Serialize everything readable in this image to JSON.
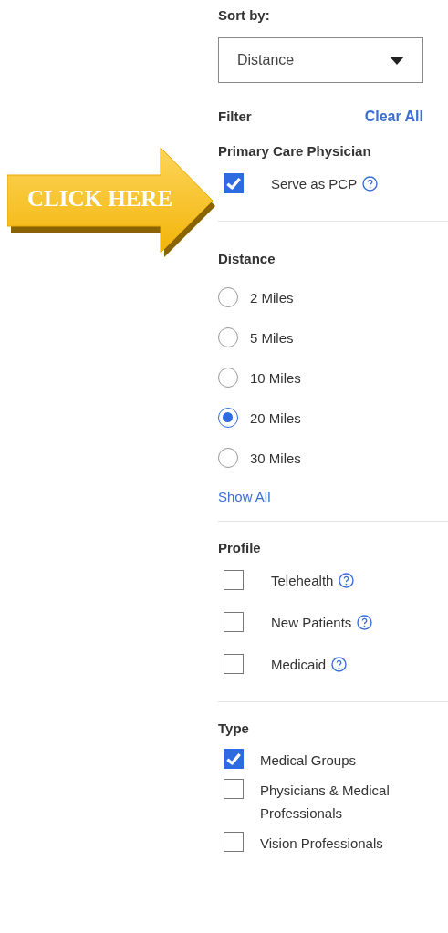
{
  "sort": {
    "label": "Sort by:",
    "value": "Distance"
  },
  "filter": {
    "title": "Filter",
    "clear": "Clear All"
  },
  "callout": {
    "text": "CLICK HERE"
  },
  "sections": [
    {
      "title": "Primary Care Physician",
      "kind": "options",
      "items": [
        {
          "label": "Serve as PCP",
          "checked": true
        }
      ]
    },
    {
      "title": "Distance",
      "kind": "radios",
      "show_all": "Show All",
      "items": [
        {
          "label": "2 Miles",
          "selected": false
        },
        {
          "label": "5 Miles",
          "selected": false
        },
        {
          "label": "10 Miles",
          "selected": false
        },
        {
          "label": "20 Miles",
          "selected": true
        },
        {
          "label": "30 Miles",
          "selected": false
        }
      ]
    },
    {
      "title": "Profile",
      "kind": "options",
      "items": [
        {
          "label": "Telehealth",
          "checked": false
        },
        {
          "label": "New Patients",
          "checked": false
        },
        {
          "label": "Medicaid",
          "checked": false
        }
      ]
    },
    {
      "title": "Type",
      "kind": "types",
      "items": [
        {
          "label": "Medical Groups",
          "checked": true
        },
        {
          "label": "Physicians & Medical Professionals",
          "checked": false
        },
        {
          "label": "Vision Professionals",
          "checked": false
        }
      ]
    }
  ]
}
